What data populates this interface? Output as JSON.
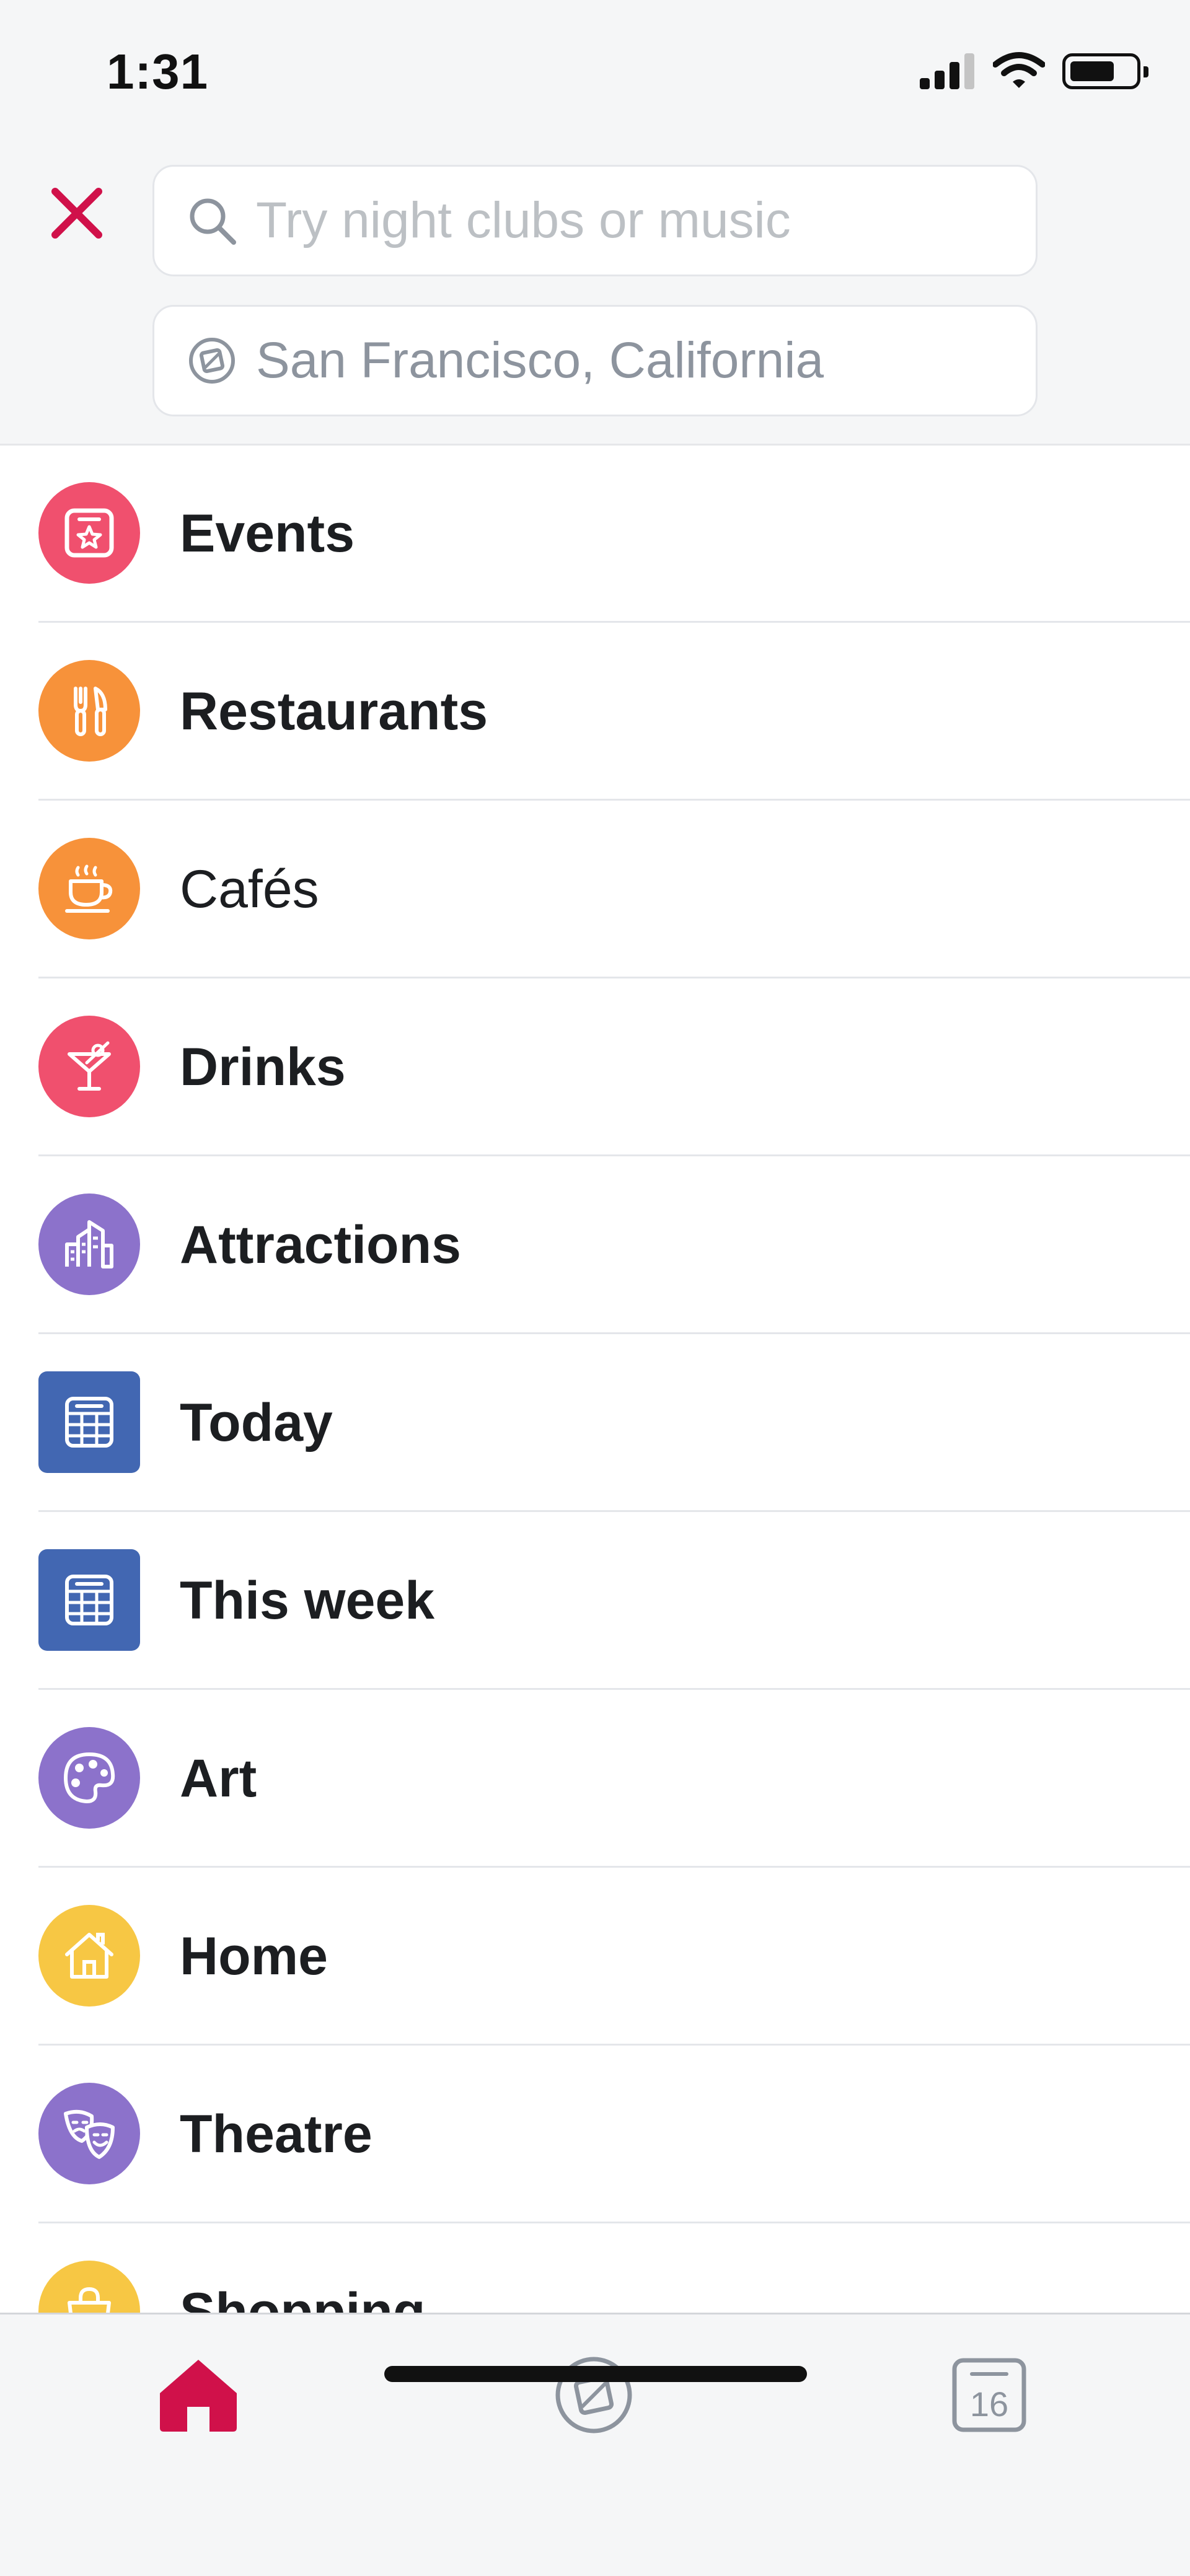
{
  "status_bar": {
    "time": "1:31"
  },
  "search": {
    "placeholder": "Try night clubs or music",
    "location": "San Francisco, California"
  },
  "colors": {
    "accent": "#d0114a",
    "pink": "#f0506e",
    "orange": "#f7923a",
    "purple": "#8c72cb",
    "blue": "#4267b2",
    "yellow": "#f7c744"
  },
  "categories": [
    {
      "label": "Events",
      "icon": "event-star-icon",
      "color": "#f0506e"
    },
    {
      "label": "Restaurants",
      "icon": "fork-knife-icon",
      "color": "#f7923a"
    },
    {
      "label": "Cafés",
      "icon": "coffee-cup-icon",
      "color": "#f7923a"
    },
    {
      "label": "Drinks",
      "icon": "cocktail-icon",
      "color": "#f0506e"
    },
    {
      "label": "Attractions",
      "icon": "buildings-icon",
      "color": "#8c72cb"
    },
    {
      "label": "Today",
      "icon": "calendar-icon",
      "color": "#4267b2"
    },
    {
      "label": "This week",
      "icon": "calendar-icon",
      "color": "#4267b2"
    },
    {
      "label": "Art",
      "icon": "palette-icon",
      "color": "#8c72cb"
    },
    {
      "label": "Home",
      "icon": "house-icon",
      "color": "#f7c744"
    },
    {
      "label": "Theatre",
      "icon": "theatre-masks-icon",
      "color": "#8c72cb"
    },
    {
      "label": "Shopping",
      "icon": "shopping-bag-icon",
      "color": "#f7c744"
    }
  ],
  "tabbar": {
    "calendar_day": "16"
  }
}
